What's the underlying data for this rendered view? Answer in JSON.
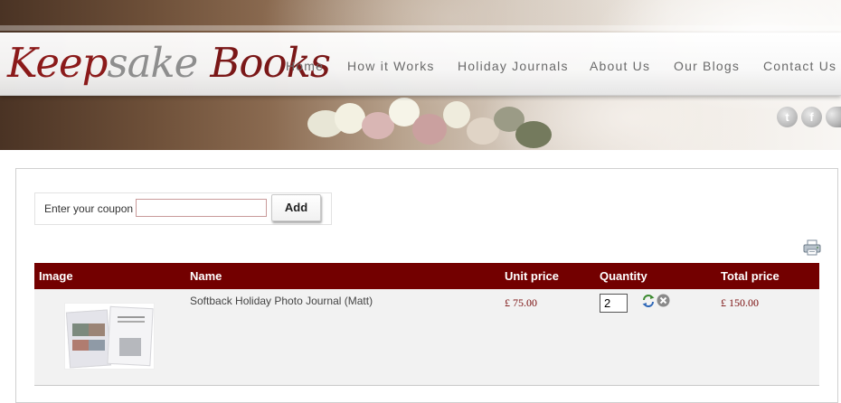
{
  "brand": {
    "logo_part1": "Keep",
    "logo_part2": "sake",
    "logo_part3": "Books"
  },
  "nav": {
    "items": [
      {
        "label": "Home"
      },
      {
        "label": "How it Works"
      },
      {
        "label": "Holiday Journals"
      },
      {
        "label": "About Us"
      },
      {
        "label": "Our Blogs"
      },
      {
        "label": "Contact Us"
      }
    ]
  },
  "social": {
    "icons": [
      "twitter-icon",
      "facebook-icon",
      "other-social-icon"
    ],
    "twitter_glyph": "t",
    "facebook_glyph": "f"
  },
  "coupon": {
    "label": "Enter your coupon",
    "value": "",
    "button": "Add"
  },
  "cart": {
    "columns": {
      "image": "Image",
      "name": "Name",
      "unit_price": "Unit price",
      "quantity": "Quantity",
      "total_price": "Total price"
    },
    "items": [
      {
        "name": "Softback Holiday Photo Journal (Matt)",
        "unit_price": "£ 75.00",
        "quantity": "2",
        "total_price": "£ 150.00"
      }
    ]
  },
  "colors": {
    "accent": "#730000",
    "price": "#7a0f0f",
    "logo_red": "#8b1a1a",
    "logo_grey": "#8e8e8e",
    "nav_text": "#6a6a6a"
  }
}
